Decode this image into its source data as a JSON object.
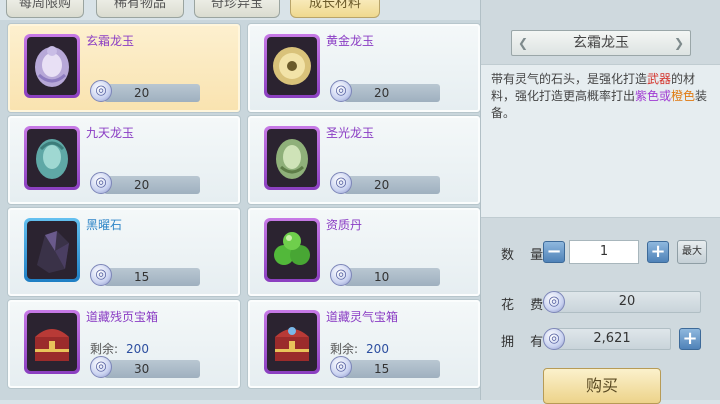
{
  "tabs": [
    "每周限购",
    "稀有物品",
    "奇珍异宝",
    "成长材料"
  ],
  "active_tab_index": 3,
  "items": [
    {
      "name": "玄霜龙玉",
      "price": "20",
      "name_color": "purple",
      "slot": "purple",
      "icon": "jade-dragon-icon"
    },
    {
      "name": "黄金龙玉",
      "price": "20",
      "name_color": "purple",
      "slot": "purple",
      "icon": "gold-jade-icon"
    },
    {
      "name": "九天龙玉",
      "price": "20",
      "name_color": "purple",
      "slot": "purple",
      "icon": "jade-dragon-icon"
    },
    {
      "name": "圣光龙玉",
      "price": "20",
      "name_color": "purple",
      "slot": "purple",
      "icon": "jade-dragon-icon"
    },
    {
      "name": "黑曜石",
      "price": "15",
      "name_color": "blue",
      "slot": "blue",
      "icon": "obsidian-icon"
    },
    {
      "name": "资质丹",
      "price": "10",
      "name_color": "purple",
      "slot": "purple",
      "icon": "green-pill-icon"
    },
    {
      "name": "道藏残页宝箱",
      "price": "30",
      "remain_label": "剩余:",
      "remain": "200",
      "name_color": "purple",
      "slot": "purple",
      "icon": "treasure-chest-icon"
    },
    {
      "name": "道藏灵气宝箱",
      "price": "15",
      "remain_label": "剩余:",
      "remain": "200",
      "name_color": "purple",
      "slot": "purple",
      "icon": "treasure-chest-icon"
    }
  ],
  "selected_index": 0,
  "detail": {
    "title": "玄霜龙玉",
    "desc_parts": [
      {
        "t": "带有灵气的石头，是强化打造",
        "c": ""
      },
      {
        "t": "武器",
        "c": "red"
      },
      {
        "t": "的材料，强化打造更高概率打出",
        "c": ""
      },
      {
        "t": "紫色或",
        "c": "purple"
      },
      {
        "t": "橙色",
        "c": "orange"
      },
      {
        "t": "装备。",
        "c": ""
      }
    ],
    "qty_label": "数 量",
    "qty": "1",
    "max_label": "最大",
    "cost_label": "花 费",
    "cost": "20",
    "own_label": "拥 有",
    "own": "2,621",
    "buy_label": "购买",
    "minus": "−",
    "plus": "+"
  },
  "currency_icon": "silver-coin-icon",
  "coin_glyph": "◎"
}
